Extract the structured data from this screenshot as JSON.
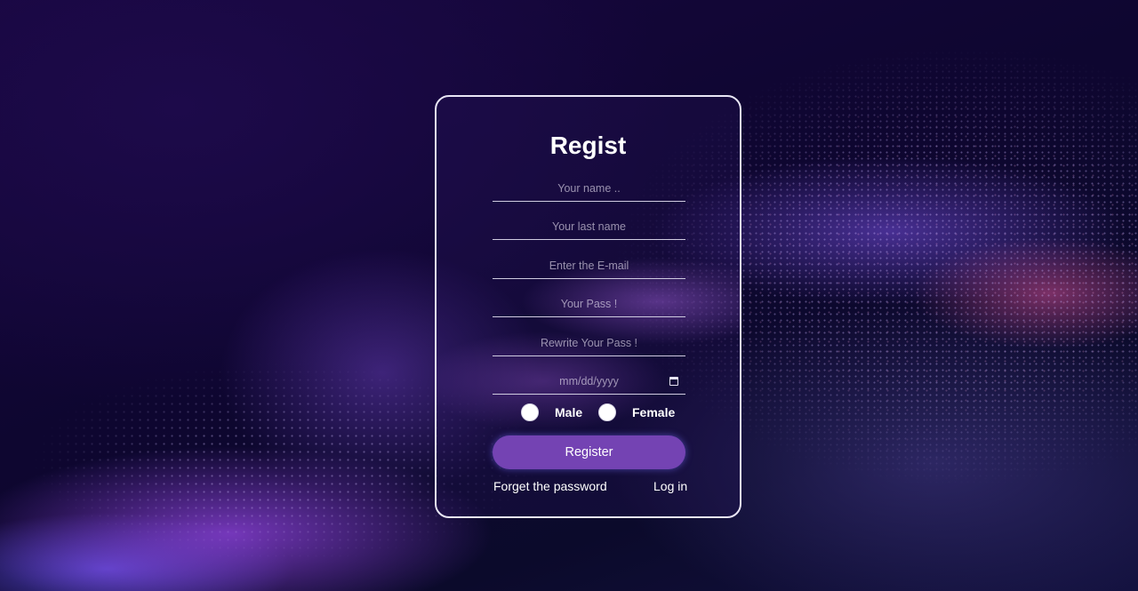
{
  "form": {
    "title": "Regist",
    "fields": {
      "first_name_placeholder": "Your name ..",
      "last_name_placeholder": "Your last name",
      "email_placeholder": "Enter the E-mail",
      "password_placeholder": "Your Pass !",
      "confirm_password_placeholder": "Rewrite Your Pass !",
      "date_placeholder": "mm/dd/yyyy"
    },
    "gender": {
      "male_label": "Male",
      "female_label": "Female"
    },
    "register_label": "Register",
    "forgot_label": "Forget the password",
    "login_label": "Log in"
  },
  "icons": {
    "date_picker": "calendar-icon"
  },
  "colors": {
    "button": "#7443b3",
    "card_border": "#e9e6f5",
    "text": "#ffffff"
  }
}
